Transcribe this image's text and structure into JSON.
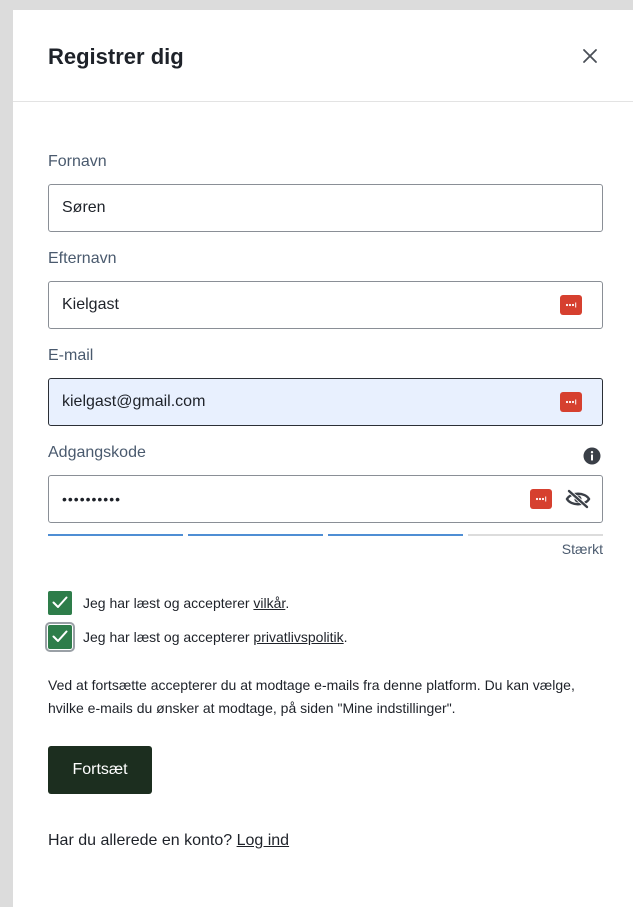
{
  "modal": {
    "title": "Registrer dig",
    "close_label": "close"
  },
  "form": {
    "first_name": {
      "label": "Fornavn",
      "value": "Søren"
    },
    "last_name": {
      "label": "Efternavn",
      "value": "Kielgast"
    },
    "email": {
      "label": "E-mail",
      "value": "kielgast@gmail.com"
    },
    "password": {
      "label": "Adgangskode",
      "value": "••••••••••"
    },
    "strength": {
      "label": "Stærkt",
      "level": 3,
      "max": 4
    }
  },
  "consents": {
    "terms": {
      "prefix": "Jeg har læst og accepterer ",
      "link": "vilkår",
      "suffix": ".",
      "checked": true
    },
    "privacy": {
      "prefix": "Jeg har læst og accepterer ",
      "link": "privatlivspolitik",
      "suffix": ".",
      "checked": true
    }
  },
  "notice": "Ved at fortsætte accepterer du at modtage e-mails fra denne platform. Du kan vælge, hvilke e-mails du ønsker at modtage, på siden \"Mine indstillinger\".",
  "submit_label": "Fortsæt",
  "footer": {
    "text": "Har du allerede en konto? ",
    "link": "Log ind"
  },
  "colors": {
    "strength_active": "#4f8ed4",
    "strength_inactive": "#dcdcdc",
    "checkbox": "#2e7d4a",
    "button": "#1c2e1f",
    "password_manager": "#d6402f"
  },
  "icons": {
    "close": "close-icon",
    "password_manager": "password-manager-icon",
    "visibility": "eye-slash-icon",
    "info": "info-icon",
    "check": "check-icon"
  }
}
